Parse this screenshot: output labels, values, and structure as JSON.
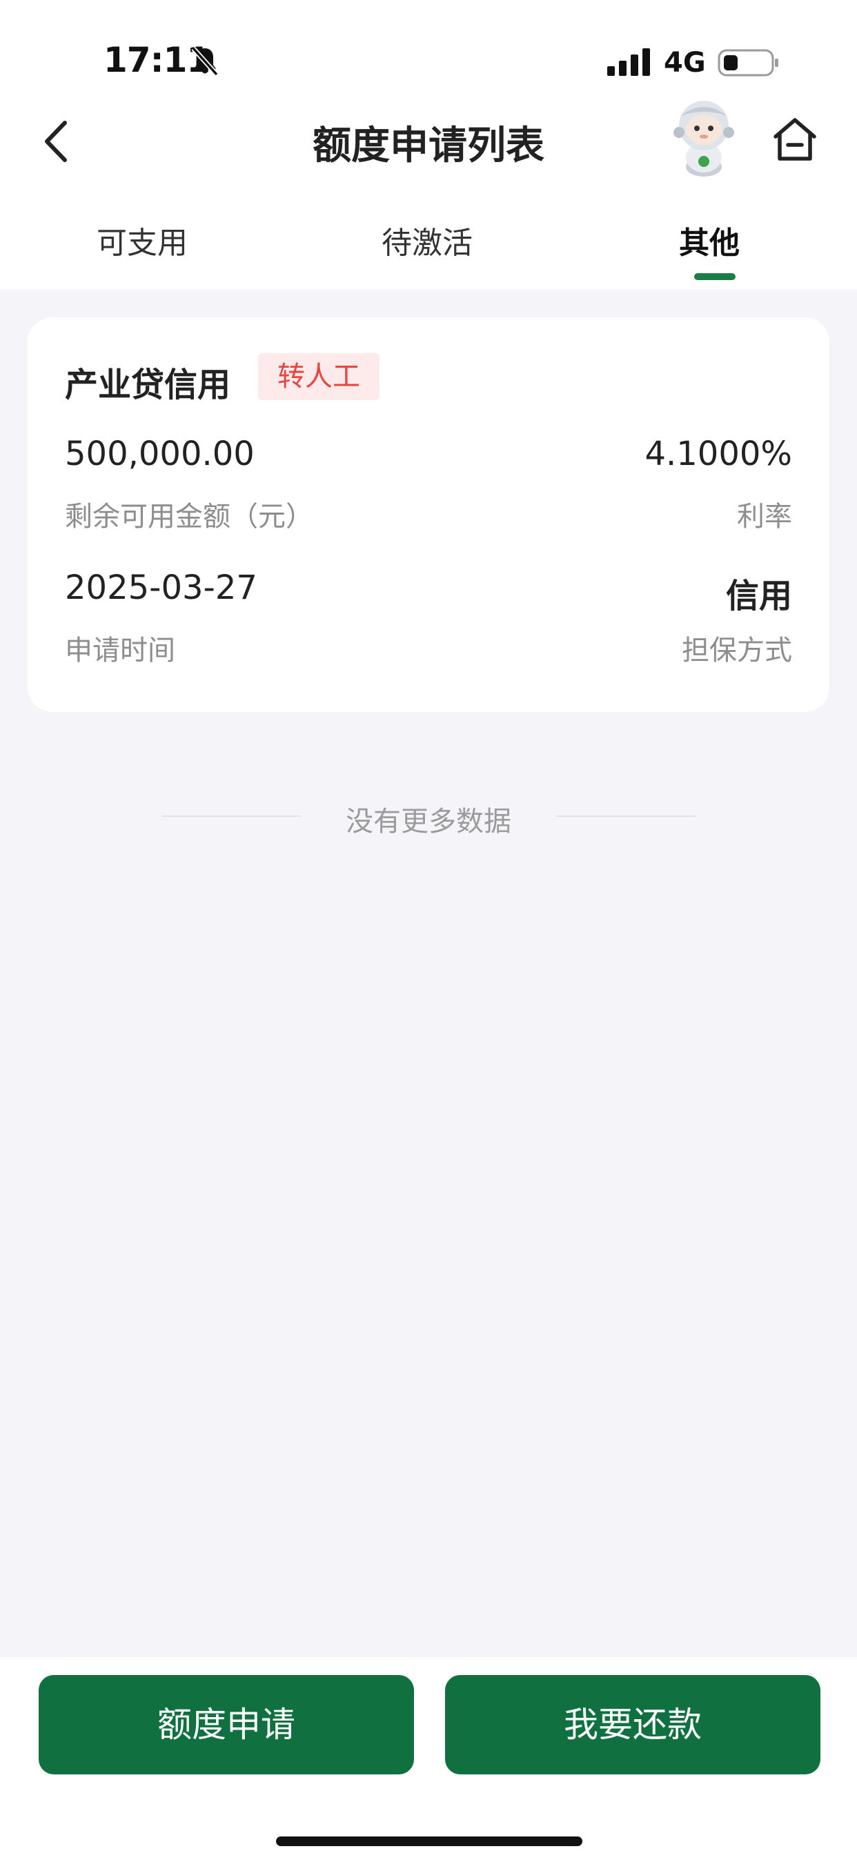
{
  "status_bar": {
    "time": "17:11",
    "network": "4G",
    "icons": [
      "bell-off-icon",
      "signal-icon",
      "battery-icon"
    ]
  },
  "nav": {
    "title": "额度申请列表",
    "back_icon": "chevron-left-icon",
    "home_icon": "home-icon"
  },
  "tabs": [
    {
      "label": "可支用",
      "active": false
    },
    {
      "label": "待激活",
      "active": false
    },
    {
      "label": "其他",
      "active": true
    }
  ],
  "card": {
    "title": "产业贷信用",
    "badge": "转人工",
    "amount_value": "500,000.00",
    "amount_label": "剩余可用金额（元）",
    "rate_value": "4.1000%",
    "rate_label": "利率",
    "date_value": "2025-03-27",
    "date_label": "申请时间",
    "guarantee_value": "信用",
    "guarantee_label": "担保方式"
  },
  "list_footer": "没有更多数据",
  "bottom_buttons": {
    "apply": "额度申请",
    "repay": "我要还款"
  },
  "colors": {
    "accent_green": "#10703f",
    "tab_indicator": "#1a7d45",
    "badge_red": "#e8453c",
    "badge_bg": "#fdeaea"
  }
}
